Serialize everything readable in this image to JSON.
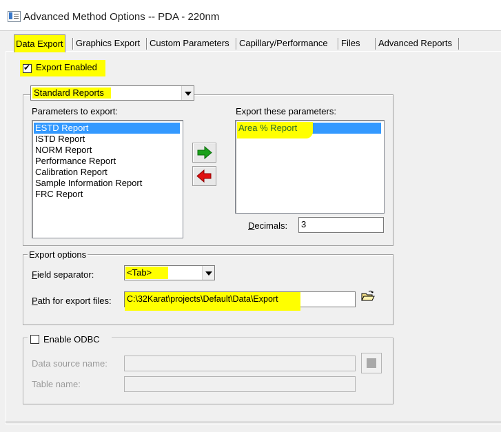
{
  "window": {
    "title": "Advanced Method Options -- PDA - 220nm"
  },
  "tabs": [
    {
      "label": "Data Export"
    },
    {
      "label": "Graphics Export"
    },
    {
      "label": "Custom Parameters"
    },
    {
      "label": "Capillary/Performance"
    },
    {
      "label": "Files"
    },
    {
      "label": "Advanced Reports"
    }
  ],
  "export_enabled": {
    "label": "Export Enabled",
    "checked": true
  },
  "report_group": {
    "report_type_selected": "Standard Reports",
    "parameters_label": "Parameters to export:",
    "parameters": [
      "ESTD Report",
      "ISTD Report",
      "NORM Report",
      "Performance Report",
      "Calibration Report",
      "Sample Information Report",
      "FRC Report"
    ],
    "parameters_selected": "ESTD Report",
    "export_label": "Export these parameters:",
    "export_items": [
      "Area % Report"
    ],
    "decimals_label": "Decimals:",
    "decimals_value": "3",
    "add_icon": "green-right-arrow-icon",
    "remove_icon": "red-left-arrow-icon"
  },
  "export_options": {
    "legend": "Export options",
    "field_separator_label": "Field separator:",
    "field_separator_value": "<Tab>",
    "path_label": "Path for export files:",
    "path_value": "C:\\32Karat\\projects\\Default\\Data\\Export",
    "browse_icon": "open-folder-icon"
  },
  "odbc": {
    "label": "Enable ODBC",
    "checked": false,
    "data_source_label": "Data source name:",
    "table_name_label": "Table name:"
  },
  "colors": {
    "highlight": "#ffff00",
    "selection": "#3399ff",
    "add_arrow": "#1aa01a",
    "remove_arrow": "#e01010"
  }
}
